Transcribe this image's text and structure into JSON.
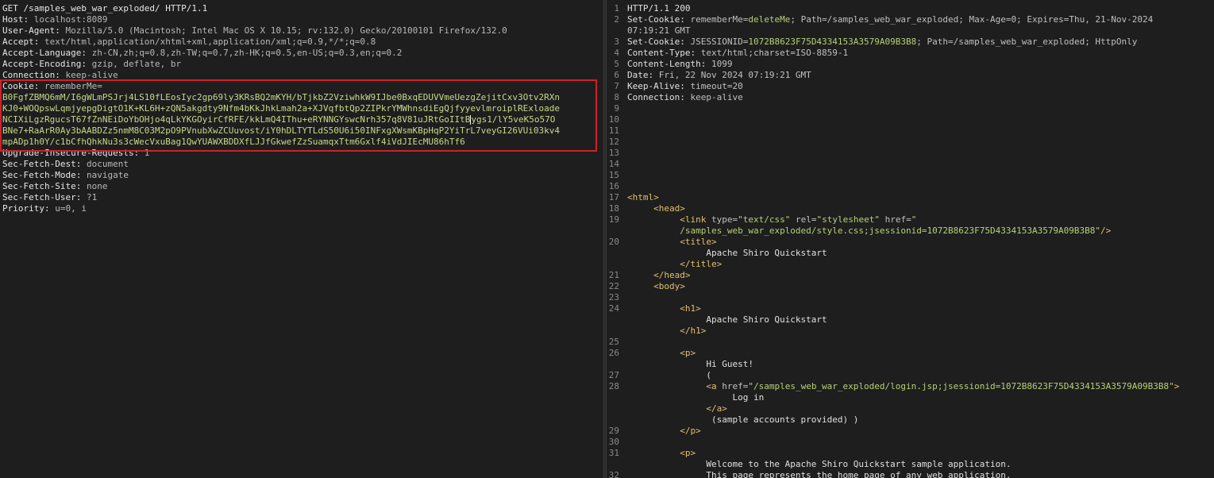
{
  "request": {
    "lines": [
      {
        "name": "GET /samples_web_war_exploded/ HTTP/1.1",
        "value": ""
      },
      {
        "name": "Host:",
        "value": " localhost:8089"
      },
      {
        "name": "User-Agent:",
        "value": " Mozilla/5.0 (Macintosh; Intel Mac OS X 10.15; rv:132.0) Gecko/20100101 Firefox/132.0"
      },
      {
        "name": "Accept:",
        "value": " text/html,application/xhtml+xml,application/xml;q=0.9,*/*;q=0.8"
      },
      {
        "name": "Accept-Language:",
        "value": " zh-CN,zh;q=0.8,zh-TW;q=0.7,zh-HK;q=0.5,en-US;q=0.3,en;q=0.2"
      },
      {
        "name": "Accept-Encoding:",
        "value": " gzip, deflate, br"
      },
      {
        "name": "Connection:",
        "value": " keep-alive"
      },
      {
        "name": "Cookie:",
        "value": " rememberMe="
      }
    ],
    "cookie_lines": [
      "B0FgfZBMQ6mM/I6gWLmPSJrj4LS10fLEosIyc2gp69ly3KRsBQ2mKYH/bTjkbZ2VziwhkW9IJbe0BxqEDUVVmeUezgZejitCxv3Otv2RXn",
      "KJ0+WOQpswLqmjyepgDigtO1K+KL6H+zQN5akgdty9Nfm4bKkJhkLmah2a+XJVqfbtQp2ZIPkrYMWhnsdiEgQjfyyevlmroiplRExloade",
      "NCIXiLgzRgucsT67fZnNEiDoYbOHjo4qLkYKGOyirCfRFE/kkLmQ4IThu+eRYNNGYswcNrh357q8V81uJRtGoIItB",
      "BNe7+RaArR0Ay3bAABDZz5nmM8C03M2pO9PVnubXwZCUuvost/iY0hDLTYTLdS50U6i50INFxgXWsmKBpHqP2YiTrL7veyGI26VUi03kv4",
      "mpADp1h0Y/c1bCfhQhkNu3s3cWecVxuBag1QwYUAWXBDDXfLJJfGkwefZzSuamqxTtm6Gxlf4iVdJIEcMU86hTf6"
    ],
    "cookie_line3_tail": "ygs1/lY5veK5o57O",
    "after_lines": [
      {
        "name": "Upgrade-Insecure-Requests:",
        "value": " 1"
      },
      {
        "name": "Sec-Fetch-Dest:",
        "value": " document"
      },
      {
        "name": "Sec-Fetch-Mode:",
        "value": " navigate"
      },
      {
        "name": "Sec-Fetch-Site:",
        "value": " none"
      },
      {
        "name": "Sec-Fetch-User:",
        "value": " ?1"
      },
      {
        "name": "Priority:",
        "value": " u=0, i"
      }
    ]
  },
  "response": {
    "l1": "HTTP/1.1 200",
    "l2a": "Set-Cookie:",
    "l2b": " rememberMe=",
    "l2c": "deleteMe",
    "l2d": "; Path=/samples_web_war_exploded; Max-Age=0; Expires=Thu, 21-Nov-2024",
    "l2e": "07:19:21 GMT",
    "l3a": "Set-Cookie:",
    "l3b": " JSESSIONID=",
    "l3c": "1072B8623F75D4334153A3579A09B3B8",
    "l3d": "; Path=/samples_web_war_exploded; HttpOnly",
    "l4a": "Content-Type:",
    "l4b": " text/html;charset=ISO-8859-1",
    "l5a": "Content-Length:",
    "l5b": " 1099",
    "l6a": "Date:",
    "l6b": " Fri, 22 Nov 2024 07:19:21 GMT",
    "l7a": "Keep-Alive:",
    "l7b": " timeout=20",
    "l8a": "Connection:",
    "l8b": " keep-alive",
    "html_open": "<html>",
    "head_open": "<head>",
    "link_a": "<link ",
    "link_type_attr": "type=",
    "link_type_val": "\"text/css\"",
    "link_rel_attr": " rel=",
    "link_rel_val": "\"stylesheet\"",
    "link_href_attr": " href=",
    "link_href_q": "\"",
    "link_href_val": "/samples_web_war_exploded/style.css;jsessionid=1072B8623F75D4334153A3579A09B3B8\"",
    "link_close": "/>",
    "title_open": "<title>",
    "title_text": "Apache Shiro Quickstart",
    "title_close": "</title>",
    "head_close": "</head>",
    "body_open": "<body>",
    "h1_open": "<h1>",
    "h1_text": "Apache Shiro Quickstart",
    "h1_close": "</h1>",
    "p_open": "<p>",
    "hi_guest": "Hi Guest!",
    "paren_open": "(",
    "a_open": "<a ",
    "a_href_attr": "href=",
    "a_href_val": "\"/samples_web_war_exploded/login.jsp;jsessionid=1072B8623F75D4334153A3579A09B3B8\"",
    "a_gt": ">",
    "login_text": "Log in",
    "a_close": "</a>",
    "sample_text": " (sample accounts provided) )",
    "p_close": "</p>",
    "welcome_text": "Welcome to the Apache Shiro Quickstart sample application.",
    "page_text": "This page represents the home page of any web application."
  },
  "line_numbers": [
    "1",
    "2",
    "3",
    "4",
    "5",
    "6",
    "7",
    "8",
    "9",
    "10",
    "11",
    "12",
    "13",
    "14",
    "15",
    "16",
    "17",
    "18",
    "19",
    "20",
    "21",
    "22",
    "23",
    "24",
    "25",
    "26",
    "27",
    "28",
    "29",
    "30",
    "31",
    "32"
  ]
}
